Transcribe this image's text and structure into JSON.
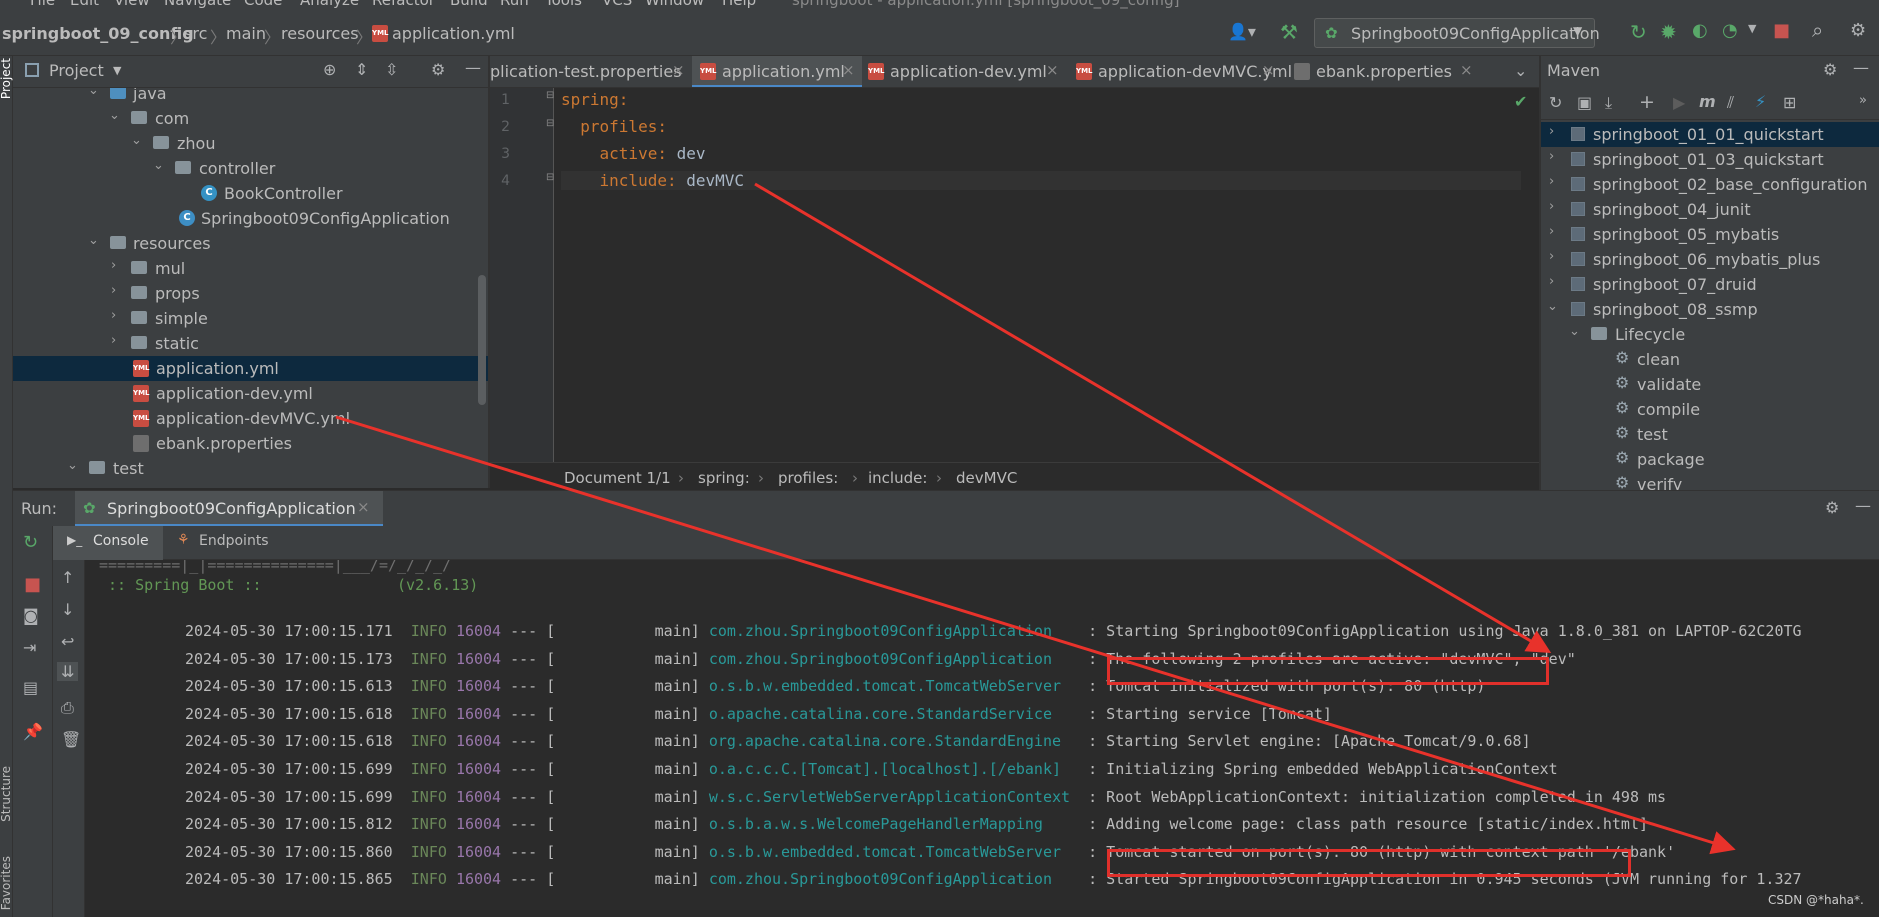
{
  "menu": [
    "File",
    "Edit",
    "View",
    "Navigate",
    "Code",
    "Analyze",
    "Refactor",
    "Build",
    "Run",
    "Tools",
    "VCS",
    "Window",
    "Help"
  ],
  "window_title": "springboot - application.yml [springboot_09_config]",
  "breadcrumbs": [
    "springboot_09_config",
    "src",
    "main",
    "resources",
    "application.yml"
  ],
  "run_config": "Springboot09ConfigApplication",
  "project_panel": {
    "title": "Project",
    "strip_label": "Project",
    "tree": [
      {
        "label": "java",
        "kind": "folder-blue",
        "arrow": "open"
      },
      {
        "label": "com",
        "kind": "folder",
        "arrow": "open"
      },
      {
        "label": "zhou",
        "kind": "folder",
        "arrow": "open"
      },
      {
        "label": "controller",
        "kind": "folder",
        "arrow": "open"
      },
      {
        "label": "BookController",
        "kind": "class",
        "arrow": ""
      },
      {
        "label": "Springboot09ConfigApplication",
        "kind": "class",
        "arrow": ""
      },
      {
        "label": "resources",
        "kind": "folder",
        "arrow": "open"
      },
      {
        "label": "mul",
        "kind": "folder",
        "arrow": "closed"
      },
      {
        "label": "props",
        "kind": "folder",
        "arrow": "closed"
      },
      {
        "label": "simple",
        "kind": "folder",
        "arrow": "closed"
      },
      {
        "label": "static",
        "kind": "folder",
        "arrow": "closed"
      },
      {
        "label": "application.yml",
        "kind": "yml",
        "arrow": "",
        "selected": true
      },
      {
        "label": "application-dev.yml",
        "kind": "yml",
        "arrow": ""
      },
      {
        "label": "application-devMVC.yml",
        "kind": "yml",
        "arrow": ""
      },
      {
        "label": "ebank.properties",
        "kind": "props",
        "arrow": ""
      },
      {
        "label": "test",
        "kind": "folder",
        "arrow": "open"
      }
    ]
  },
  "editor": {
    "tabs": [
      {
        "label": "plication-test.properties",
        "active": false
      },
      {
        "label": "application.yml",
        "active": true
      },
      {
        "label": "application-dev.yml",
        "active": false
      },
      {
        "label": "application-devMVC.yml",
        "active": false
      },
      {
        "label": "ebank.properties",
        "active": false
      }
    ],
    "lines": [
      {
        "n": "1",
        "key": "spring",
        "value": ""
      },
      {
        "n": "2",
        "key": "  profiles",
        "value": ""
      },
      {
        "n": "3",
        "key": "    active",
        "value": " dev"
      },
      {
        "n": "4",
        "key": "    include",
        "value": " devMVC"
      }
    ],
    "breadcrumb": [
      "Document 1/1",
      "spring:",
      "profiles:",
      "include:",
      "devMVC"
    ]
  },
  "maven": {
    "title": "Maven",
    "items": [
      {
        "label": "springboot_01_01_quickstart",
        "type": "module",
        "selected": true
      },
      {
        "label": "springboot_01_03_quickstart",
        "type": "module"
      },
      {
        "label": "springboot_02_base_configuration",
        "type": "module"
      },
      {
        "label": "springboot_04_junit",
        "type": "module"
      },
      {
        "label": "springboot_05_mybatis",
        "type": "module"
      },
      {
        "label": "springboot_06_mybatis_plus",
        "type": "module"
      },
      {
        "label": "springboot_07_druid",
        "type": "module"
      },
      {
        "label": "springboot_08_ssmp",
        "type": "module-open"
      },
      {
        "label": "Lifecycle",
        "type": "folder"
      },
      {
        "label": "clean",
        "type": "goal"
      },
      {
        "label": "validate",
        "type": "goal"
      },
      {
        "label": "compile",
        "type": "goal"
      },
      {
        "label": "test",
        "type": "goal"
      },
      {
        "label": "package",
        "type": "goal"
      },
      {
        "label": "verify",
        "type": "goal"
      }
    ]
  },
  "run": {
    "label": "Run:",
    "tab": "Springboot09ConfigApplication",
    "subtabs": [
      "Console",
      "Endpoints"
    ],
    "banner_partial": "=========|_|==============|___/=/_/_/_/",
    "spring_boot": " :: Spring Boot ::               (v2.6.13)",
    "log": [
      {
        "ts": "2024-05-30 17:00:15.171",
        "level": "INFO",
        "pid": "16004",
        "sep": " --- [",
        "thread": "           main]",
        "logger": "com.zhou.Springboot09ConfigApplication   ",
        "msg": " : Starting Springboot09ConfigApplication using Java 1.8.0_381 on LAPTOP-62C20TG"
      },
      {
        "ts": "2024-05-30 17:00:15.173",
        "level": "INFO",
        "pid": "16004",
        "sep": " --- [",
        "thread": "           main]",
        "logger": "com.zhou.Springboot09ConfigApplication   ",
        "msg": " : The following 2 profiles are active: \"devMVC\", \"dev\""
      },
      {
        "ts": "2024-05-30 17:00:15.613",
        "level": "INFO",
        "pid": "16004",
        "sep": " --- [",
        "thread": "           main]",
        "logger": "o.s.b.w.embedded.tomcat.TomcatWebServer  ",
        "msg": " : Tomcat initialized with port(s): 80 (http)"
      },
      {
        "ts": "2024-05-30 17:00:15.618",
        "level": "INFO",
        "pid": "16004",
        "sep": " --- [",
        "thread": "           main]",
        "logger": "o.apache.catalina.core.StandardService   ",
        "msg": " : Starting service [Tomcat]"
      },
      {
        "ts": "2024-05-30 17:00:15.618",
        "level": "INFO",
        "pid": "16004",
        "sep": " --- [",
        "thread": "           main]",
        "logger": "org.apache.catalina.core.StandardEngine  ",
        "msg": " : Starting Servlet engine: [Apache Tomcat/9.0.68]"
      },
      {
        "ts": "2024-05-30 17:00:15.699",
        "level": "INFO",
        "pid": "16004",
        "sep": " --- [",
        "thread": "           main]",
        "logger": "o.a.c.c.C.[Tomcat].[localhost].[/ebank]  ",
        "msg": " : Initializing Spring embedded WebApplicationContext"
      },
      {
        "ts": "2024-05-30 17:00:15.699",
        "level": "INFO",
        "pid": "16004",
        "sep": " --- [",
        "thread": "           main]",
        "logger": "w.s.c.ServletWebServerApplicationContext ",
        "msg": " : Root WebApplicationContext: initialization completed in 498 ms"
      },
      {
        "ts": "2024-05-30 17:00:15.812",
        "level": "INFO",
        "pid": "16004",
        "sep": " --- [",
        "thread": "           main]",
        "logger": "o.s.b.a.w.s.WelcomePageHandlerMapping    ",
        "msg": " : Adding welcome page: class path resource [static/index.html]"
      },
      {
        "ts": "2024-05-30 17:00:15.860",
        "level": "INFO",
        "pid": "16004",
        "sep": " --- [",
        "thread": "           main]",
        "logger": "o.s.b.w.embedded.tomcat.TomcatWebServer  ",
        "msg": " : Tomcat started on port(s): 80 (http) with context path '/ebank'"
      },
      {
        "ts": "2024-05-30 17:00:15.865",
        "level": "INFO",
        "pid": "16004",
        "sep": " --- [",
        "thread": "           main]",
        "logger": "com.zhou.Springboot09ConfigApplication   ",
        "msg": " : Started Springboot09ConfigApplication in 0.945 seconds (JVM running for 1.327"
      }
    ]
  },
  "side_labels": {
    "structure": "Structure",
    "favorites": "Favorites"
  },
  "watermark": "CSDN @*haha*."
}
